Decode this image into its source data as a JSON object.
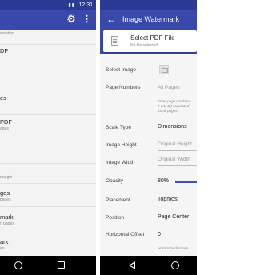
{
  "colors": {
    "statusbar": "#2b3a92",
    "appbar": "#3949ab",
    "accent": "#3f51b5",
    "navbar": "#000000"
  },
  "left": {
    "statusbar": {
      "time": "12:31",
      "icons": [
        "signal-icon",
        "battery-icon"
      ]
    },
    "appbar": {
      "icons": [
        "gear-icon",
        "more-vert-icon"
      ]
    },
    "items": [
      {
        "title": "",
        "subtitle": "entation"
      },
      {
        "title": "DF",
        "subtitle": ""
      },
      {
        "title": "es",
        "subtitle": ""
      },
      {
        "title": "PDF",
        "subtitle": "ages"
      },
      {
        "title": "",
        "subtitle": "margin"
      },
      {
        "title": "ges",
        "subtitle": "pages"
      },
      {
        "title": "mark",
        "subtitle": "n pages"
      },
      {
        "title": "ark",
        "subtitle": "es"
      }
    ],
    "navbar": {
      "icons": [
        "home-circle-icon",
        "recents-square-icon"
      ]
    }
  },
  "right": {
    "appbar": {
      "title": "Image Watermark",
      "icon": "back-arrow-icon"
    },
    "card": {
      "title": "Select PDF File",
      "subtitle": "No file selected",
      "icon": "file-icon"
    },
    "form": {
      "select_image": "Select Image",
      "page_numbers": "Page Numbers",
      "page_numbers_placeholder": "All Pages",
      "page_numbers_note": [
        "Enter page numbers",
        "6-24, 42) separated",
        "for all pages."
      ],
      "scale_type": "Scale Type",
      "scale_type_value": "Dimensions",
      "image_height": "Image Height",
      "image_height_placeholder": "Original Height",
      "image_width": "Image Width",
      "image_width_placeholder": "Original Width",
      "opacity": "Opacity",
      "opacity_value": "80%",
      "opacity_level": 0.8,
      "placement": "Placement",
      "placement_value": "Topmost",
      "position": "Position",
      "position_value": "Page Center",
      "horizontal_offset": "Horizontal Offset",
      "horizontal_offset_value": "0",
      "horizontal_note": "Horizontal distance"
    },
    "navbar": {
      "icons": [
        "back-triangle-icon",
        "home-circle-icon"
      ]
    }
  }
}
